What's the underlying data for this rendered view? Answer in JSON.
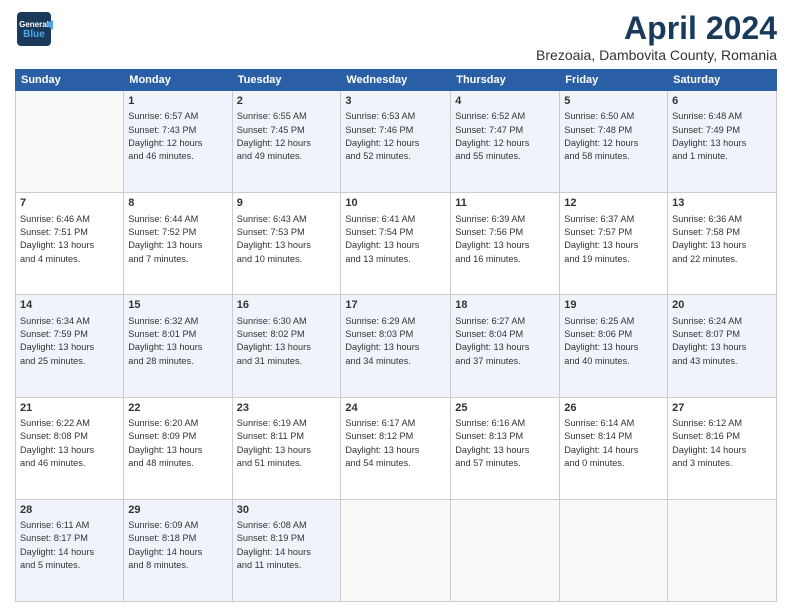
{
  "header": {
    "logo_line1": "General",
    "logo_line2": "Blue",
    "month": "April 2024",
    "location": "Brezoaia, Dambovita County, Romania"
  },
  "weekdays": [
    "Sunday",
    "Monday",
    "Tuesday",
    "Wednesday",
    "Thursday",
    "Friday",
    "Saturday"
  ],
  "weeks": [
    [
      {
        "day": "",
        "info": ""
      },
      {
        "day": "1",
        "info": "Sunrise: 6:57 AM\nSunset: 7:43 PM\nDaylight: 12 hours\nand 46 minutes."
      },
      {
        "day": "2",
        "info": "Sunrise: 6:55 AM\nSunset: 7:45 PM\nDaylight: 12 hours\nand 49 minutes."
      },
      {
        "day": "3",
        "info": "Sunrise: 6:53 AM\nSunset: 7:46 PM\nDaylight: 12 hours\nand 52 minutes."
      },
      {
        "day": "4",
        "info": "Sunrise: 6:52 AM\nSunset: 7:47 PM\nDaylight: 12 hours\nand 55 minutes."
      },
      {
        "day": "5",
        "info": "Sunrise: 6:50 AM\nSunset: 7:48 PM\nDaylight: 12 hours\nand 58 minutes."
      },
      {
        "day": "6",
        "info": "Sunrise: 6:48 AM\nSunset: 7:49 PM\nDaylight: 13 hours\nand 1 minute."
      }
    ],
    [
      {
        "day": "7",
        "info": "Sunrise: 6:46 AM\nSunset: 7:51 PM\nDaylight: 13 hours\nand 4 minutes."
      },
      {
        "day": "8",
        "info": "Sunrise: 6:44 AM\nSunset: 7:52 PM\nDaylight: 13 hours\nand 7 minutes."
      },
      {
        "day": "9",
        "info": "Sunrise: 6:43 AM\nSunset: 7:53 PM\nDaylight: 13 hours\nand 10 minutes."
      },
      {
        "day": "10",
        "info": "Sunrise: 6:41 AM\nSunset: 7:54 PM\nDaylight: 13 hours\nand 13 minutes."
      },
      {
        "day": "11",
        "info": "Sunrise: 6:39 AM\nSunset: 7:56 PM\nDaylight: 13 hours\nand 16 minutes."
      },
      {
        "day": "12",
        "info": "Sunrise: 6:37 AM\nSunset: 7:57 PM\nDaylight: 13 hours\nand 19 minutes."
      },
      {
        "day": "13",
        "info": "Sunrise: 6:36 AM\nSunset: 7:58 PM\nDaylight: 13 hours\nand 22 minutes."
      }
    ],
    [
      {
        "day": "14",
        "info": "Sunrise: 6:34 AM\nSunset: 7:59 PM\nDaylight: 13 hours\nand 25 minutes."
      },
      {
        "day": "15",
        "info": "Sunrise: 6:32 AM\nSunset: 8:01 PM\nDaylight: 13 hours\nand 28 minutes."
      },
      {
        "day": "16",
        "info": "Sunrise: 6:30 AM\nSunset: 8:02 PM\nDaylight: 13 hours\nand 31 minutes."
      },
      {
        "day": "17",
        "info": "Sunrise: 6:29 AM\nSunset: 8:03 PM\nDaylight: 13 hours\nand 34 minutes."
      },
      {
        "day": "18",
        "info": "Sunrise: 6:27 AM\nSunset: 8:04 PM\nDaylight: 13 hours\nand 37 minutes."
      },
      {
        "day": "19",
        "info": "Sunrise: 6:25 AM\nSunset: 8:06 PM\nDaylight: 13 hours\nand 40 minutes."
      },
      {
        "day": "20",
        "info": "Sunrise: 6:24 AM\nSunset: 8:07 PM\nDaylight: 13 hours\nand 43 minutes."
      }
    ],
    [
      {
        "day": "21",
        "info": "Sunrise: 6:22 AM\nSunset: 8:08 PM\nDaylight: 13 hours\nand 46 minutes."
      },
      {
        "day": "22",
        "info": "Sunrise: 6:20 AM\nSunset: 8:09 PM\nDaylight: 13 hours\nand 48 minutes."
      },
      {
        "day": "23",
        "info": "Sunrise: 6:19 AM\nSunset: 8:11 PM\nDaylight: 13 hours\nand 51 minutes."
      },
      {
        "day": "24",
        "info": "Sunrise: 6:17 AM\nSunset: 8:12 PM\nDaylight: 13 hours\nand 54 minutes."
      },
      {
        "day": "25",
        "info": "Sunrise: 6:16 AM\nSunset: 8:13 PM\nDaylight: 13 hours\nand 57 minutes."
      },
      {
        "day": "26",
        "info": "Sunrise: 6:14 AM\nSunset: 8:14 PM\nDaylight: 14 hours\nand 0 minutes."
      },
      {
        "day": "27",
        "info": "Sunrise: 6:12 AM\nSunset: 8:16 PM\nDaylight: 14 hours\nand 3 minutes."
      }
    ],
    [
      {
        "day": "28",
        "info": "Sunrise: 6:11 AM\nSunset: 8:17 PM\nDaylight: 14 hours\nand 5 minutes."
      },
      {
        "day": "29",
        "info": "Sunrise: 6:09 AM\nSunset: 8:18 PM\nDaylight: 14 hours\nand 8 minutes."
      },
      {
        "day": "30",
        "info": "Sunrise: 6:08 AM\nSunset: 8:19 PM\nDaylight: 14 hours\nand 11 minutes."
      },
      {
        "day": "",
        "info": ""
      },
      {
        "day": "",
        "info": ""
      },
      {
        "day": "",
        "info": ""
      },
      {
        "day": "",
        "info": ""
      }
    ]
  ]
}
